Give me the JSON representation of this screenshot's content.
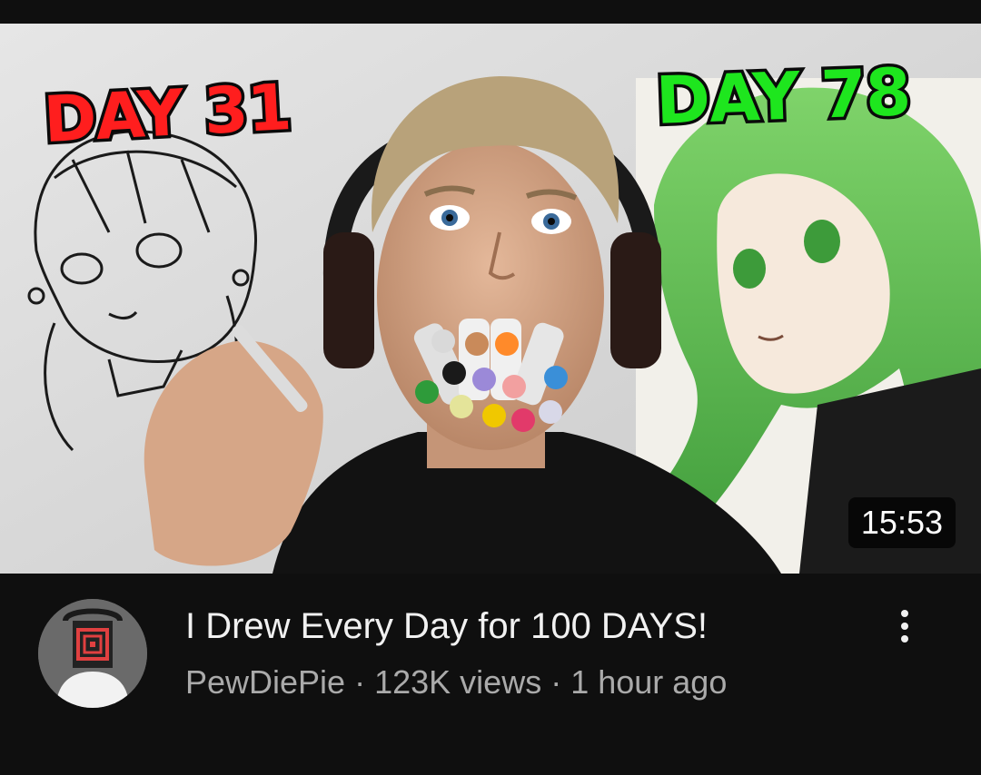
{
  "video": {
    "badges": {
      "left": "DAY 31",
      "right": "DAY 78"
    },
    "duration": "15:53",
    "title": "I Drew Every Day for 100 DAYS!",
    "channel": "PewDiePie",
    "views": "123K views",
    "separator": "·",
    "age": "1 hour ago"
  },
  "icons": {
    "more": "more-vert-icon",
    "avatar": "channel-avatar"
  },
  "colors": {
    "background": "#0f0f0f",
    "title": "#f1f1f1",
    "meta": "#aaaaaa",
    "badge_left": "#ff1e1e",
    "badge_right": "#1ee61e"
  }
}
